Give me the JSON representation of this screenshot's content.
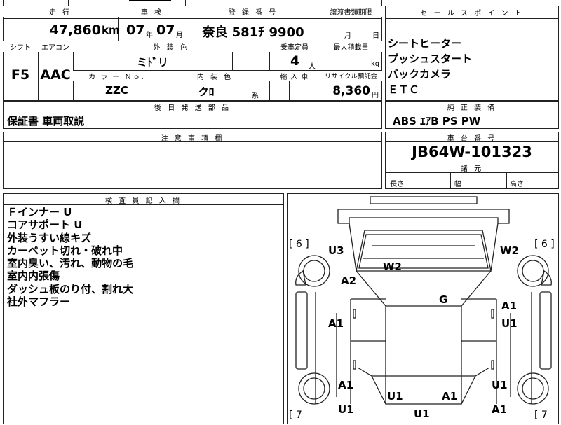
{
  "summary": {
    "headers": {
      "mileage": "走 行",
      "inspection": "車 検",
      "registration": "登 録 番 号",
      "transfer_deadline": "譲渡書類期限",
      "shift": "シフト",
      "aircon": "エアコン",
      "exterior_color": "外 装 色",
      "capacity": "乗車定員",
      "max_load": "最大積載量",
      "color_no": "カ ラ ー Ｎｏ.",
      "interior_color": "内 装 色",
      "import": "輸 入 車",
      "recycle": "リサイクル預託金"
    },
    "mileage": "47,860",
    "mileage_unit": "km",
    "inspection_year": "07",
    "inspection_year_unit": "年",
    "inspection_month": "07",
    "inspection_month_unit": "月",
    "registration": "奈良 581ﾁ 9900",
    "transfer_month_unit": "月",
    "transfer_day_unit": "日",
    "shift": "F5",
    "aircon": "AAC",
    "exterior_color": "ミﾄﾞリ",
    "capacity": "4",
    "capacity_unit": "人",
    "max_load_unit": "kg",
    "color_no": "ZZC",
    "interior_color": "クﾛ",
    "interior_color_suffix": "系",
    "recycle_amount": "8,360",
    "recycle_unit": "円"
  },
  "delivery": {
    "header": "後 日 発 送 部 品",
    "value": "保証書 車両取説"
  },
  "caution": {
    "header": "注 意 事 項 欄"
  },
  "sales_points": {
    "header": "セ ー ル ス ポ イ ン ト",
    "items": [
      "シートヒーター",
      "プッシュスタート",
      "バックカメラ",
      "ＥＴＣ"
    ]
  },
  "standard_equipment": {
    "header": "純 正 装 備",
    "value": "ABS ｴｱB PS PW"
  },
  "chassis": {
    "header": "車 台 番 号",
    "value": "JB64W-101323"
  },
  "dimensions": {
    "header": "諸 元",
    "length": "長さ",
    "width": "幅",
    "height": "高さ"
  },
  "inspector": {
    "header": "検 査 員 記 入 欄",
    "lines": [
      "Ｆインナー U",
      "コアサポート U",
      "外装うすい線キズ",
      "カーペット切れ・破れ中",
      "室内臭い、汚れ、動物の毛",
      "室内内張傷",
      "ダッシュ板のり付、割れ大",
      "社外マフラー"
    ]
  },
  "diagram": {
    "tire_front_left": "[ 6 ]",
    "tire_front_right": "[ 6 ]",
    "tire_rear_left": "[ 7",
    "tire_rear_right": "[ 7",
    "marks": [
      "U3",
      "W2",
      "W2",
      "A2",
      "G",
      "A1",
      "A1",
      "U1",
      "A1",
      "U1",
      "U1",
      "A1",
      "U1",
      "A1",
      "U1"
    ]
  }
}
